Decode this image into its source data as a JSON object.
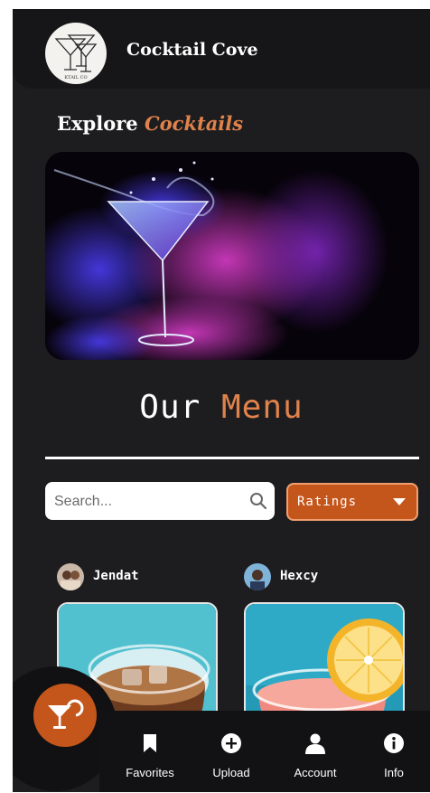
{
  "header": {
    "app_title": "Cocktail Cove",
    "logo_text": "KTAIL CO"
  },
  "explore": {
    "prefix": "Explore",
    "accent": "Cocktails"
  },
  "menu": {
    "word1": "Our",
    "word2": "Menu"
  },
  "search": {
    "placeholder": "Search...",
    "value": ""
  },
  "filter": {
    "selected": "Ratings"
  },
  "posts": [
    {
      "user": "Jendat"
    },
    {
      "user": "Hexcy"
    }
  ],
  "nav": [
    {
      "label": "Favorites",
      "icon": "bookmark-icon"
    },
    {
      "label": "Upload",
      "icon": "plus-circle-icon"
    },
    {
      "label": "Account",
      "icon": "user-icon"
    },
    {
      "label": "Info",
      "icon": "info-icon"
    }
  ],
  "colors": {
    "accent": "#e0824b",
    "button": "#c4561c",
    "background": "#1d1d1f"
  }
}
